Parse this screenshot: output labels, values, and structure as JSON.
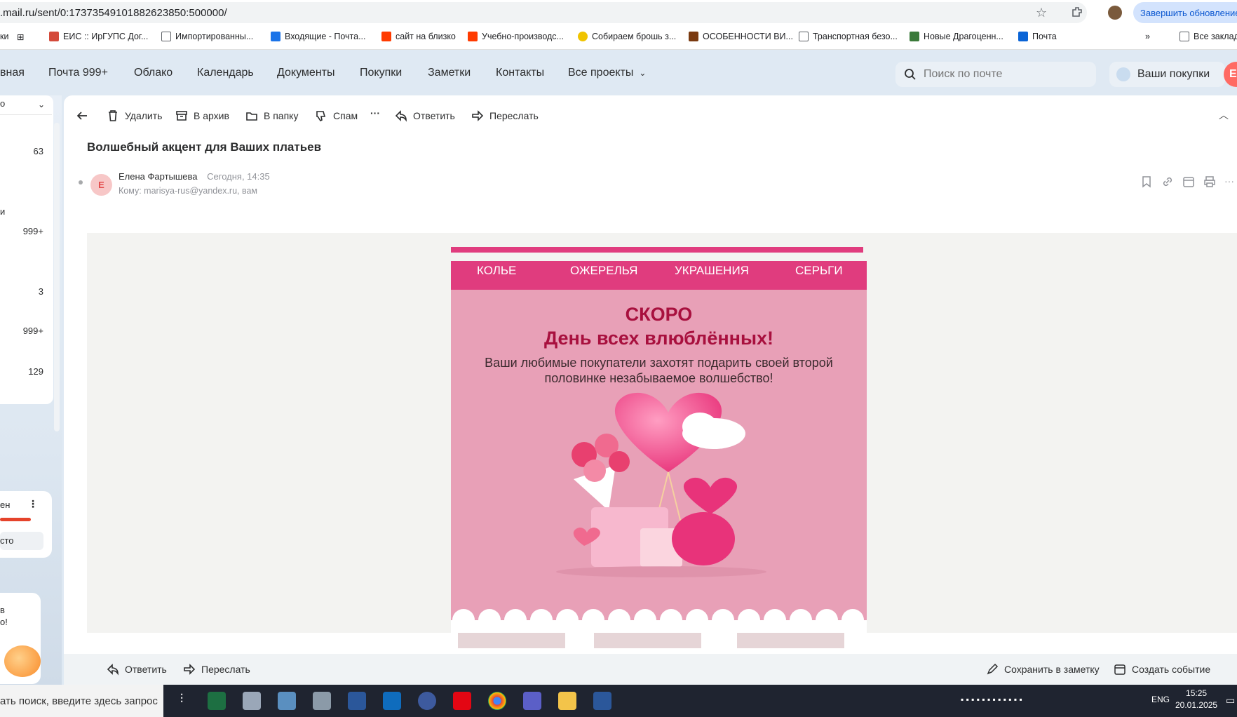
{
  "browser": {
    "url": ".mail.ru/sent/0:17373549101882623850:500000/",
    "update_button": "Завершить обновление"
  },
  "bookmarks": [
    {
      "label": "ки",
      "color": "#555555"
    },
    {
      "label": "ЕИС :: ИрГУПС Дог...",
      "color": "#d44a3a"
    },
    {
      "label": "Импортированны...",
      "color": "#5f6368"
    },
    {
      "label": "Входящие - Почта...",
      "color": "#1a73e8"
    },
    {
      "label": "сайт на близко",
      "color": "#ff3b00"
    },
    {
      "label": "Учебно-производс...",
      "color": "#ff3b00"
    },
    {
      "label": "Собираем брошь з...",
      "color": "#f0c400"
    },
    {
      "label": "ОСОБЕННОСТИ ВИ...",
      "color": "#7a3a10"
    },
    {
      "label": "Транспортная безо...",
      "color": "#5f6368"
    },
    {
      "label": "Новые Драгоценн...",
      "color": "#3a7a3a"
    },
    {
      "label": "Почта",
      "color": "#0a64d6"
    },
    {
      "label": "Все заклад",
      "color": "#5f6368"
    }
  ],
  "mail_nav": {
    "items": [
      "вная",
      "Почта 999+",
      "Облако",
      "Календарь",
      "Документы",
      "Покупки",
      "Заметки",
      "Контакты",
      "Все проекты"
    ],
    "search_placeholder": "Поиск по почте",
    "purchases": "Ваши покупки",
    "user_initial": "Е"
  },
  "sidebar": {
    "select_label": "о",
    "counts": [
      "63",
      "999+",
      "3",
      "999+",
      "129"
    ],
    "fragment_label": "и",
    "card_label": "ен",
    "card_button": "сто",
    "promo_line1": "в",
    "promo_line2": "о!"
  },
  "toolbar": {
    "delete": "Удалить",
    "archive": "В архив",
    "folder": "В папку",
    "spam": "Спам",
    "more": "···",
    "reply": "Ответить",
    "forward": "Переслать"
  },
  "message": {
    "subject": "Волшебный акцент для Ваших платьев",
    "avatar_letter": "Е",
    "sender": "Елена Фартышева",
    "date": "Сегодня, 14:35",
    "recipients": "Кому: marisya-rus@yandex.ru,   вам"
  },
  "newsletter": {
    "menu": [
      "КОЛЬЕ",
      "ОЖЕРЕЛЬЯ",
      "УКРАШЕНИЯ",
      "СЕРЬГИ"
    ],
    "title1": "СКОРО",
    "title2": "День всех влюблённых!",
    "subtitle": "Ваши любимые покупатели захотят подарить своей второй половинке незабываемое волшебство!"
  },
  "bottom_bar": {
    "reply": "Ответить",
    "forward": "Переслать",
    "save_note": "Сохранить в заметку",
    "create_event": "Создать событие"
  },
  "taskbar": {
    "search": "ать поиск, введите здесь запрос",
    "lang": "ENG",
    "time": "15:25",
    "date": "20.01.2025"
  },
  "colors": {
    "brand_pink": "#e03c7e",
    "hero_pink": "#e8a0b7",
    "title_red": "#a8103e"
  }
}
